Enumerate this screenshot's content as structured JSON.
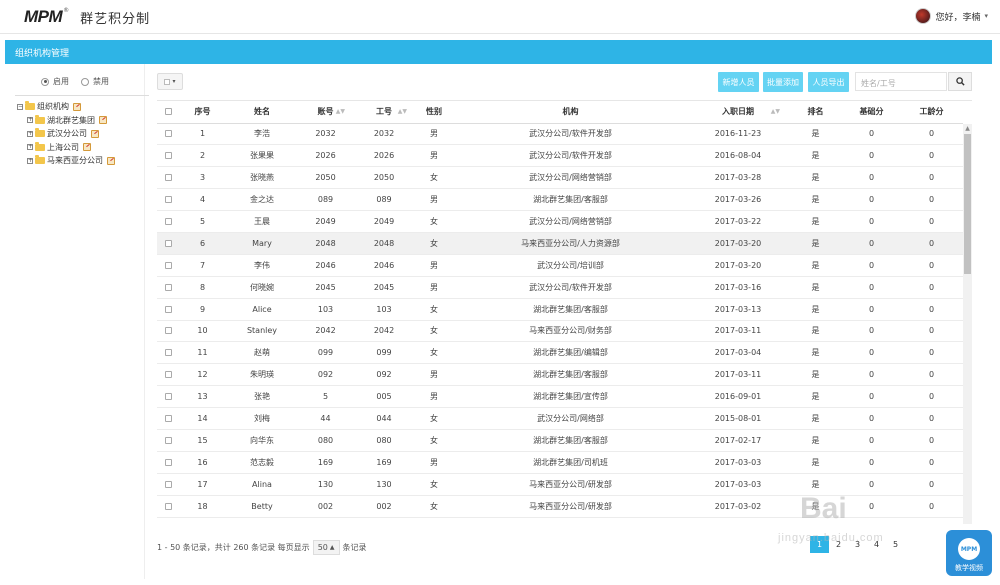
{
  "app": {
    "logo_mark": "MPM",
    "logo_reg": "®",
    "logo_text": "群艺积分制",
    "greeting": "您好，李楠"
  },
  "module": {
    "title": "组织机构管理"
  },
  "left": {
    "radio_enabled": "启用",
    "radio_disabled": "禁用",
    "tree": [
      {
        "label": "组织机构",
        "level": 0
      },
      {
        "label": "湖北群艺集团",
        "level": 1
      },
      {
        "label": "武汉分公司",
        "level": 1
      },
      {
        "label": "上海公司",
        "level": 1
      },
      {
        "label": "马来西亚分公司",
        "level": 1
      }
    ]
  },
  "toolbar": {
    "new_person": "新增人员",
    "batch_add": "批量添加",
    "export": "人员导出",
    "search_placeholder": "姓名/工号"
  },
  "table": {
    "headers": [
      "序号",
      "姓名",
      "账号",
      "工号",
      "性别",
      "机构",
      "入职日期",
      "排名",
      "基础分",
      "工龄分"
    ],
    "rows": [
      [
        "1",
        "李浩",
        "2032",
        "2032",
        "男",
        "武汉分公司/软件开发部",
        "2016-11-23",
        "是",
        "0",
        "0"
      ],
      [
        "2",
        "张果果",
        "2026",
        "2026",
        "男",
        "武汉分公司/软件开发部",
        "2016-08-04",
        "是",
        "0",
        "0"
      ],
      [
        "3",
        "张晓燕",
        "2050",
        "2050",
        "女",
        "武汉分公司/网络营销部",
        "2017-03-28",
        "是",
        "0",
        "0"
      ],
      [
        "4",
        "金之达",
        "089",
        "089",
        "男",
        "湖北群艺集团/客服部",
        "2017-03-26",
        "是",
        "0",
        "0"
      ],
      [
        "5",
        "王晨",
        "2049",
        "2049",
        "女",
        "武汉分公司/网络营销部",
        "2017-03-22",
        "是",
        "0",
        "0"
      ],
      [
        "6",
        "Mary",
        "2048",
        "2048",
        "女",
        "马来西亚分公司/人力资源部",
        "2017-03-20",
        "是",
        "0",
        "0"
      ],
      [
        "7",
        "李伟",
        "2046",
        "2046",
        "男",
        "武汉分公司/培训部",
        "2017-03-20",
        "是",
        "0",
        "0"
      ],
      [
        "8",
        "何晓婉",
        "2045",
        "2045",
        "男",
        "武汉分公司/软件开发部",
        "2017-03-16",
        "是",
        "0",
        "0"
      ],
      [
        "9",
        "Alice",
        "103",
        "103",
        "女",
        "湖北群艺集团/客服部",
        "2017-03-13",
        "是",
        "0",
        "0"
      ],
      [
        "10",
        "Stanley",
        "2042",
        "2042",
        "女",
        "马来西亚分公司/财务部",
        "2017-03-11",
        "是",
        "0",
        "0"
      ],
      [
        "11",
        "赵萌",
        "099",
        "099",
        "女",
        "湖北群艺集团/编辑部",
        "2017-03-04",
        "是",
        "0",
        "0"
      ],
      [
        "12",
        "朱明瑛",
        "092",
        "092",
        "男",
        "湖北群艺集团/客服部",
        "2017-03-11",
        "是",
        "0",
        "0"
      ],
      [
        "13",
        "张艳",
        "5",
        "005",
        "男",
        "湖北群艺集团/宣传部",
        "2016-09-01",
        "是",
        "0",
        "0"
      ],
      [
        "14",
        "刘梅",
        "44",
        "044",
        "女",
        "武汉分公司/网络部",
        "2015-08-01",
        "是",
        "0",
        "0"
      ],
      [
        "15",
        "向华东",
        "080",
        "080",
        "女",
        "湖北群艺集团/客服部",
        "2017-02-17",
        "是",
        "0",
        "0"
      ],
      [
        "16",
        "范志毅",
        "169",
        "169",
        "男",
        "湖北群艺集团/司机班",
        "2017-03-03",
        "是",
        "0",
        "0"
      ],
      [
        "17",
        "Alina",
        "130",
        "130",
        "女",
        "马来西亚分公司/研发部",
        "2017-03-03",
        "是",
        "0",
        "0"
      ],
      [
        "18",
        "Betty",
        "002",
        "002",
        "女",
        "马来西亚分公司/研发部",
        "2017-03-02",
        "是",
        "0",
        "0"
      ]
    ]
  },
  "footer": {
    "range": "1 - 50 条记录，共计 260 条记录 每页显示",
    "per_page": "50",
    "per_page_suffix": "条记录",
    "pages": [
      "1",
      "2",
      "3",
      "4",
      "5"
    ],
    "active_page": "1"
  },
  "watermark": {
    "text": "Bai",
    "sub": "jingyan.baidu.com",
    "badge_logo": "MPM",
    "badge_caption": "教学视频"
  }
}
